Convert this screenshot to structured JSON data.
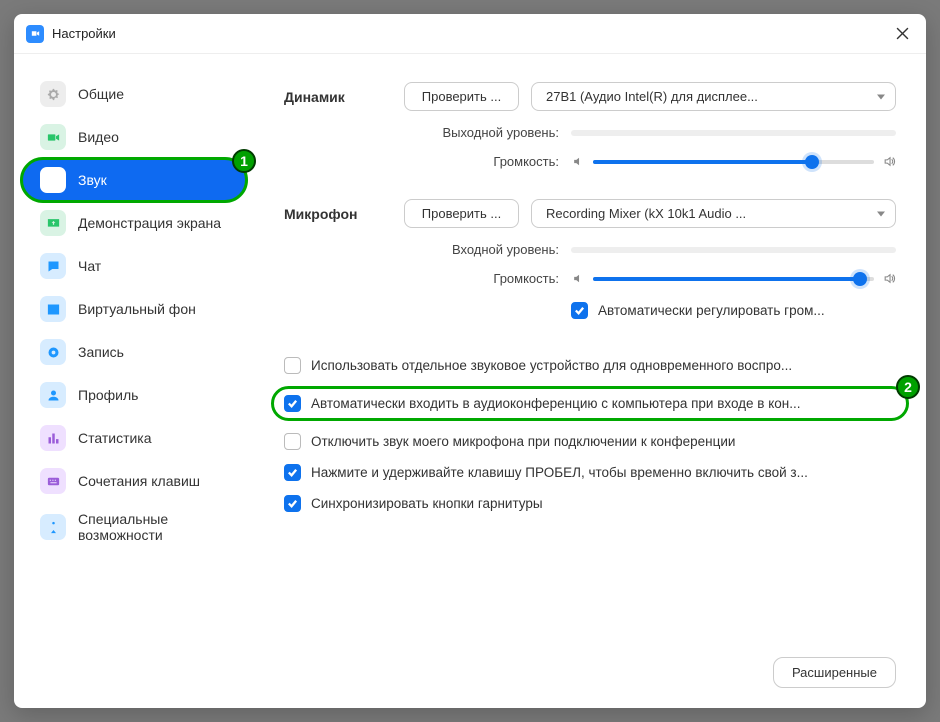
{
  "window": {
    "title": "Настройки"
  },
  "sidebar": {
    "items": [
      {
        "label": "Общие"
      },
      {
        "label": "Видео"
      },
      {
        "label": "Звук"
      },
      {
        "label": "Демонстрация экрана"
      },
      {
        "label": "Чат"
      },
      {
        "label": "Виртуальный фон"
      },
      {
        "label": "Запись"
      },
      {
        "label": "Профиль"
      },
      {
        "label": "Статистика"
      },
      {
        "label": "Сочетания клавиш"
      },
      {
        "label": "Специальные возможности"
      }
    ]
  },
  "badges": {
    "one": "1",
    "two": "2"
  },
  "speaker": {
    "section": "Динамик",
    "test": "Проверить ...",
    "device": "27B1 (Аудио Intel(R) для дисплее...",
    "output_level": "Выходной уровень:",
    "volume": "Громкость:",
    "level_pct": 78
  },
  "mic": {
    "section": "Микрофон",
    "test": "Проверить ...",
    "device": "Recording Mixer (kX 10k1 Audio ...",
    "input_level": "Входной уровень:",
    "volume": "Громкость:",
    "level_pct": 95,
    "auto_adjust": "Автоматически регулировать гром..."
  },
  "options": {
    "separate_device": "Использовать отдельное звуковое устройство для одновременного воспро...",
    "auto_join": "Автоматически входить в аудиоконференцию с компьютера при входе в кон...",
    "mute_on_join": "Отключить звук моего микрофона при подключении к конференции",
    "push_to_talk": "Нажмите и удерживайте клавишу ПРОБЕЛ, чтобы временно включить свой з...",
    "sync_headset": "Синхронизировать кнопки гарнитуры"
  },
  "footer": {
    "advanced": "Расширенные"
  }
}
